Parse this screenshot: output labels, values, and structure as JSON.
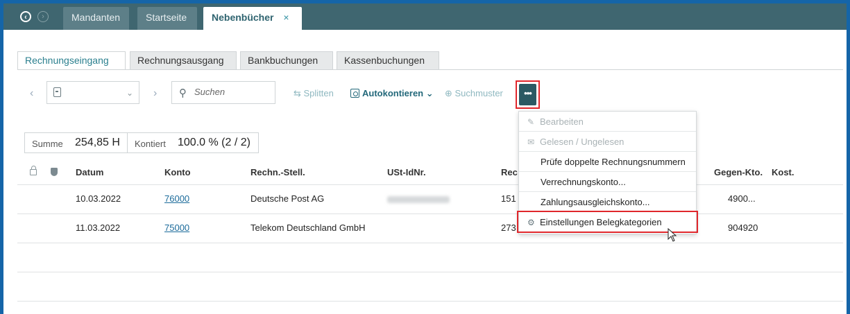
{
  "header": {
    "nav_back_icon": "circle-arrow-left-icon",
    "nav_forward_icon": "circle-arrow-right-icon",
    "tabs": [
      {
        "label": "Mandanten"
      },
      {
        "label": "Startseite"
      },
      {
        "label": "Nebenbücher",
        "close": "×",
        "active": true
      }
    ]
  },
  "subtabs": [
    {
      "label": "Rechnungseingang",
      "active": true
    },
    {
      "label": "Rechnungsausgang"
    },
    {
      "label": "Bankbuchungen"
    },
    {
      "label": "Kassenbuchungen"
    }
  ],
  "toolbar": {
    "prev": "‹",
    "next": "›",
    "search_placeholder": "Suchen",
    "split_label": "Splitten",
    "autokontieren_label": "Autokontieren",
    "suchmuster_label": "Suchmuster",
    "more_label": "•••"
  },
  "summary": {
    "summe_label": "Summe",
    "summe_value": "254,85 H",
    "kontiert_label": "Kontiert",
    "kontiert_value": "100.0 % (2 / 2)"
  },
  "table": {
    "columns": [
      "Datum",
      "Konto",
      "Rechn.-Stell.",
      "USt-IdNr.",
      "Rec",
      "Gegen-Kto.",
      "Kost."
    ],
    "rows": [
      {
        "datum": "10.03.2022",
        "konto": "76000",
        "rechnsteller": "Deutsche Post AG",
        "rechnr": "151",
        "gegenkto": "4900..."
      },
      {
        "datum": "11.03.2022",
        "konto": "75000",
        "rechnsteller": "Telekom Deutschland GmbH",
        "rechnr": "273",
        "gegenkto": "904920"
      }
    ]
  },
  "menu": {
    "items": [
      {
        "label": "Bearbeiten",
        "icon": "pencil-icon",
        "disabled": true
      },
      {
        "label": "Gelesen / Ungelesen",
        "icon": "envelope-icon",
        "disabled": true
      },
      {
        "label": "Prüfe doppelte Rechnungsnummern"
      },
      {
        "label": "Verrechnungskonto..."
      },
      {
        "label": "Zahlungsausgleichskonto..."
      },
      {
        "label": "Einstellungen Belegkategorien",
        "icon": "gear-icon",
        "highlighted": true
      }
    ]
  },
  "colors": {
    "frame": "#1565a8",
    "header": "#3f6670",
    "accent": "#2b5963",
    "highlight_border": "#e0262b"
  }
}
